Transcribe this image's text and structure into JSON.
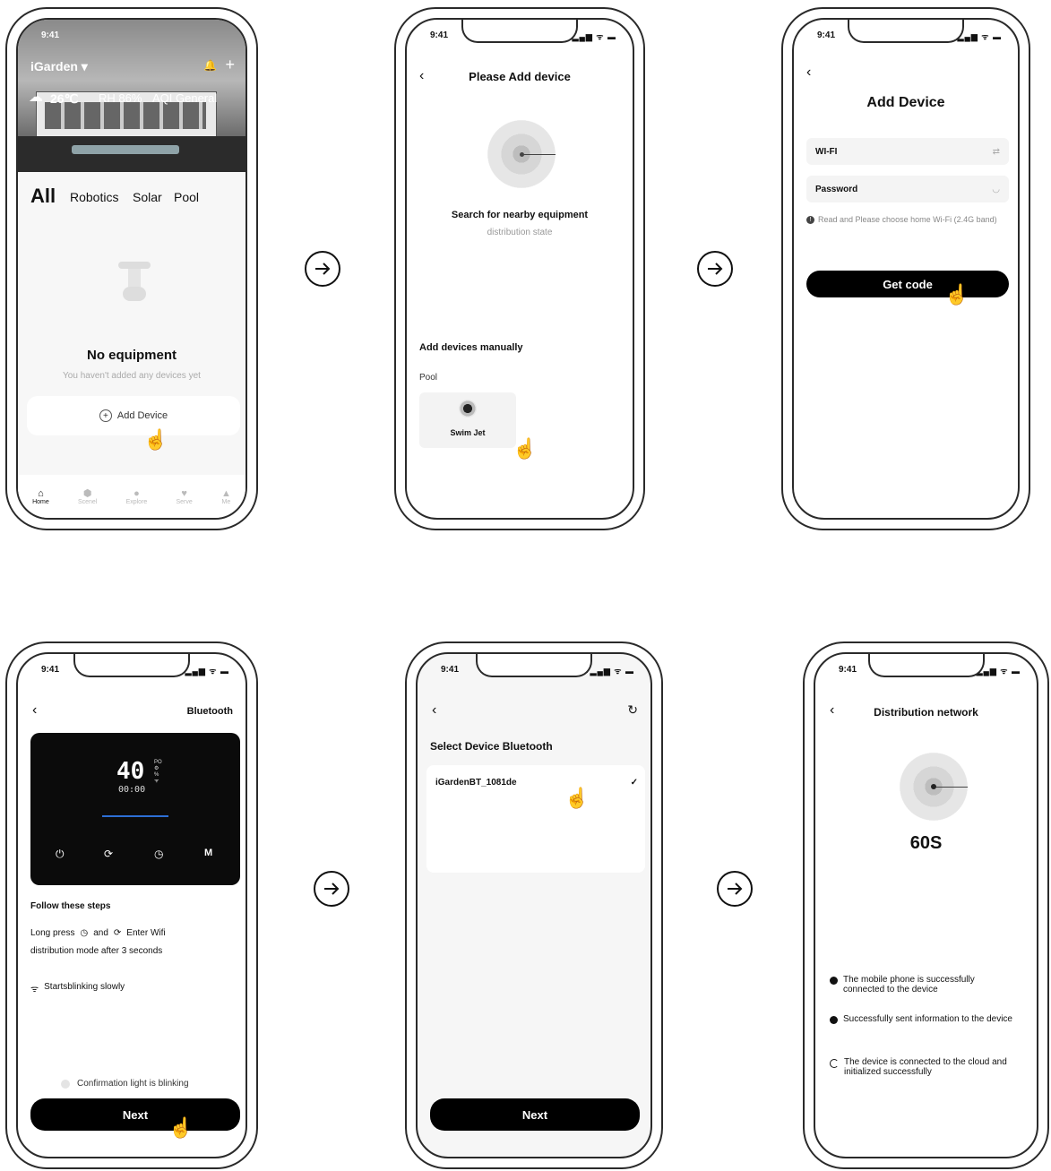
{
  "screen1": {
    "time": "9:41",
    "app_name": "iGarden ▾",
    "weather": {
      "temp": "26℃",
      "humidity": "RH 86%",
      "aqi": "AQI General"
    },
    "tabs": [
      "All",
      "Robotics",
      "Solar",
      "Pool"
    ],
    "empty_title": "No equipment",
    "empty_sub": "You haven't added any devices yet",
    "add_device": "Add Device",
    "nav": [
      "Home",
      "Scenel",
      "Explore",
      "Serve",
      "Me"
    ]
  },
  "screen2": {
    "time": "9:41",
    "title": "Please Add device",
    "search_text": "Search for nearby equipment",
    "search_sub": "distribution state",
    "manual_title": "Add devices manually",
    "category": "Pool",
    "device_name": "Swim Jet"
  },
  "screen3": {
    "time": "9:41",
    "title": "Add Device",
    "wifi_label": "WI-FI",
    "password_label": "Password",
    "hint": "Read and Please choose home Wi-Fi (2.4G band)",
    "button": "Get code"
  },
  "screen4": {
    "time": "9:41",
    "title": "Bluetooth",
    "display_value": "40",
    "display_time": "00:00",
    "steps_title": "Follow these steps",
    "steps_line1_a": "Long press",
    "steps_line1_b": "and",
    "steps_line1_c": "Enter Wifi",
    "steps_line2": "distribution mode after 3 seconds",
    "blink_text": "Startsblinking slowly",
    "confirm_text": "Confirmation light is blinking",
    "button": "Next"
  },
  "screen5": {
    "time": "9:41",
    "title": "Select Device Bluetooth",
    "device": "iGardenBT_1081de",
    "button": "Next"
  },
  "screen6": {
    "time": "9:41",
    "title": "Distribution network",
    "countdown": "60S",
    "steps": [
      "The mobile phone is successfully connected to the device",
      "Successfully sent information to the device",
      "The device is connected to the cloud and initialized successfully"
    ]
  }
}
